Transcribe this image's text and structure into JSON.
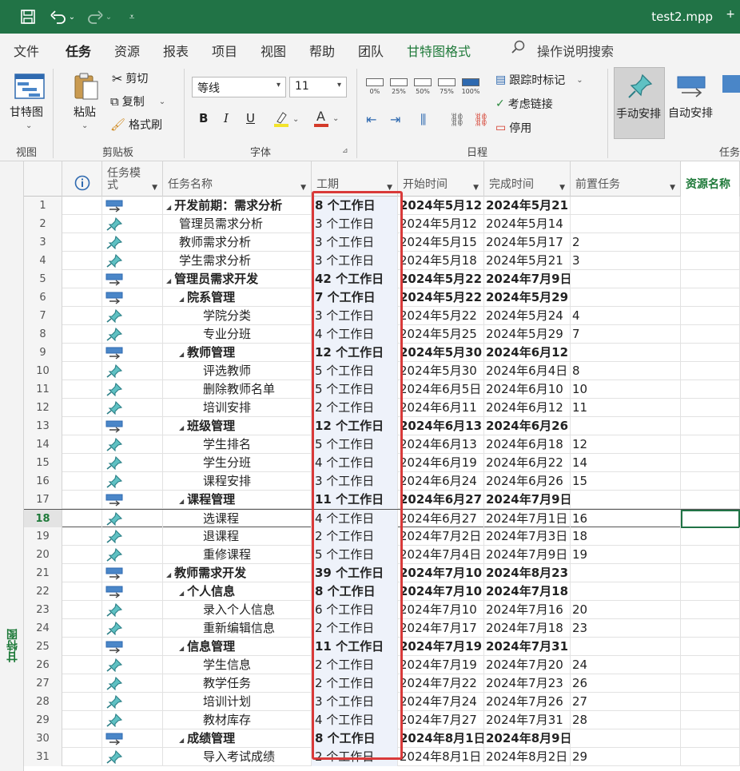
{
  "title_bar": {
    "filename": "test2.mpp",
    "extra": "+"
  },
  "ribbon_tabs": [
    "文件",
    "任务",
    "资源",
    "报表",
    "项目",
    "视图",
    "帮助",
    "团队",
    "甘特图格式"
  ],
  "tell_me": "操作说明搜索",
  "ribbon": {
    "gantt_chart": "甘特图",
    "paste": "粘贴",
    "cut": "剪切",
    "copy": "复制",
    "format_painter": "格式刷",
    "font_name": "等线",
    "font_size": "11",
    "bold": "B",
    "italic": "I",
    "underline": "U",
    "pct": [
      "0%",
      "25%",
      "50%",
      "75%",
      "100%"
    ],
    "track": "跟踪时标记",
    "respect_links": "考虑链接",
    "inactivate": "停用",
    "manual": "手动安排",
    "auto": "自动安排",
    "groups": {
      "view": "视图",
      "clipboard": "剪贴板",
      "font": "字体",
      "schedule": "日程",
      "tasks": "任务"
    }
  },
  "sidebar_label": "甘特图",
  "columns": {
    "mode": "任务模\n式",
    "name": "任务名称",
    "duration": "工期",
    "start": "开始时间",
    "finish": "完成时间",
    "pred": "前置任务",
    "resource": "资源名称"
  },
  "rows": [
    {
      "id": "1",
      "level": 0,
      "summary": true,
      "name": "开发前期：需求分析",
      "duration": "8 个工作日",
      "start": "2024年5月12",
      "finish": "2024年5月21",
      "pred": ""
    },
    {
      "id": "2",
      "level": 1,
      "summary": false,
      "name": "管理员需求分析",
      "duration": "3 个工作日",
      "start": "2024年5月12",
      "finish": "2024年5月14",
      "pred": ""
    },
    {
      "id": "3",
      "level": 1,
      "summary": false,
      "name": "教师需求分析",
      "duration": "3 个工作日",
      "start": "2024年5月15",
      "finish": "2024年5月17",
      "pred": "2"
    },
    {
      "id": "4",
      "level": 1,
      "summary": false,
      "name": "学生需求分析",
      "duration": "3 个工作日",
      "start": "2024年5月18",
      "finish": "2024年5月21",
      "pred": "3"
    },
    {
      "id": "5",
      "level": 0,
      "summary": true,
      "name": "管理员需求开发",
      "duration": "42 个工作日",
      "start": "2024年5月22",
      "finish": "2024年7月9日",
      "pred": ""
    },
    {
      "id": "6",
      "level": 1,
      "summary": true,
      "name": "院系管理",
      "duration": "7 个工作日",
      "start": "2024年5月22",
      "finish": "2024年5月29",
      "pred": ""
    },
    {
      "id": "7",
      "level": 2,
      "summary": false,
      "name": "学院分类",
      "duration": "3 个工作日",
      "start": "2024年5月22",
      "finish": "2024年5月24",
      "pred": "4"
    },
    {
      "id": "8",
      "level": 2,
      "summary": false,
      "name": "专业分班",
      "duration": "4 个工作日",
      "start": "2024年5月25",
      "finish": "2024年5月29",
      "pred": "7"
    },
    {
      "id": "9",
      "level": 1,
      "summary": true,
      "name": "教师管理",
      "duration": "12 个工作日",
      "start": "2024年5月30",
      "finish": "2024年6月12",
      "pred": ""
    },
    {
      "id": "10",
      "level": 2,
      "summary": false,
      "name": "评选教师",
      "duration": "5 个工作日",
      "start": "2024年5月30",
      "finish": "2024年6月4日",
      "pred": "8"
    },
    {
      "id": "11",
      "level": 2,
      "summary": false,
      "name": "删除教师名单",
      "duration": "5 个工作日",
      "start": "2024年6月5日",
      "finish": "2024年6月10",
      "pred": "10"
    },
    {
      "id": "12",
      "level": 2,
      "summary": false,
      "name": "培训安排",
      "duration": "2 个工作日",
      "start": "2024年6月11",
      "finish": "2024年6月12",
      "pred": "11"
    },
    {
      "id": "13",
      "level": 1,
      "summary": true,
      "name": "班级管理",
      "duration": "12 个工作日",
      "start": "2024年6月13",
      "finish": "2024年6月26",
      "pred": ""
    },
    {
      "id": "14",
      "level": 2,
      "summary": false,
      "name": "学生排名",
      "duration": "5 个工作日",
      "start": "2024年6月13",
      "finish": "2024年6月18",
      "pred": "12"
    },
    {
      "id": "15",
      "level": 2,
      "summary": false,
      "name": "学生分班",
      "duration": "4 个工作日",
      "start": "2024年6月19",
      "finish": "2024年6月22",
      "pred": "14"
    },
    {
      "id": "16",
      "level": 2,
      "summary": false,
      "name": "课程安排",
      "duration": "3 个工作日",
      "start": "2024年6月24",
      "finish": "2024年6月26",
      "pred": "15"
    },
    {
      "id": "17",
      "level": 1,
      "summary": true,
      "name": "课程管理",
      "duration": "11 个工作日",
      "start": "2024年6月27",
      "finish": "2024年7月9日",
      "pred": ""
    },
    {
      "id": "18",
      "level": 2,
      "summary": false,
      "name": "选课程",
      "duration": "4 个工作日",
      "start": "2024年6月27",
      "finish": "2024年7月1日",
      "pred": "16",
      "selected": true
    },
    {
      "id": "19",
      "level": 2,
      "summary": false,
      "name": "退课程",
      "duration": "2 个工作日",
      "start": "2024年7月2日",
      "finish": "2024年7月3日",
      "pred": "18"
    },
    {
      "id": "20",
      "level": 2,
      "summary": false,
      "name": "重修课程",
      "duration": "5 个工作日",
      "start": "2024年7月4日",
      "finish": "2024年7月9日",
      "pred": "19"
    },
    {
      "id": "21",
      "level": 0,
      "summary": true,
      "name": "教师需求开发",
      "duration": "39 个工作日",
      "start": "2024年7月10",
      "finish": "2024年8月23",
      "pred": ""
    },
    {
      "id": "22",
      "level": 1,
      "summary": true,
      "name": "个人信息",
      "duration": "8 个工作日",
      "start": "2024年7月10",
      "finish": "2024年7月18",
      "pred": ""
    },
    {
      "id": "23",
      "level": 2,
      "summary": false,
      "name": "录入个人信息",
      "duration": "6 个工作日",
      "start": "2024年7月10",
      "finish": "2024年7月16",
      "pred": "20"
    },
    {
      "id": "24",
      "level": 2,
      "summary": false,
      "name": "重新编辑信息",
      "duration": "2 个工作日",
      "start": "2024年7月17",
      "finish": "2024年7月18",
      "pred": "23"
    },
    {
      "id": "25",
      "level": 1,
      "summary": true,
      "name": "信息管理",
      "duration": "11 个工作日",
      "start": "2024年7月19",
      "finish": "2024年7月31",
      "pred": ""
    },
    {
      "id": "26",
      "level": 2,
      "summary": false,
      "name": "学生信息",
      "duration": "2 个工作日",
      "start": "2024年7月19",
      "finish": "2024年7月20",
      "pred": "24"
    },
    {
      "id": "27",
      "level": 2,
      "summary": false,
      "name": "教学任务",
      "duration": "2 个工作日",
      "start": "2024年7月22",
      "finish": "2024年7月23",
      "pred": "26"
    },
    {
      "id": "28",
      "level": 2,
      "summary": false,
      "name": "培训计划",
      "duration": "3 个工作日",
      "start": "2024年7月24",
      "finish": "2024年7月26",
      "pred": "27"
    },
    {
      "id": "29",
      "level": 2,
      "summary": false,
      "name": "教材库存",
      "duration": "4 个工作日",
      "start": "2024年7月27",
      "finish": "2024年7月31",
      "pred": "28"
    },
    {
      "id": "30",
      "level": 1,
      "summary": true,
      "name": "成绩管理",
      "duration": "8 个工作日",
      "start": "2024年8月1日",
      "finish": "2024年8月9日",
      "pred": ""
    },
    {
      "id": "31",
      "level": 2,
      "summary": false,
      "name": "导入考试成绩",
      "duration": "2 个工作日",
      "start": "2024年8月1日",
      "finish": "2024年8月2日",
      "pred": "29"
    }
  ]
}
